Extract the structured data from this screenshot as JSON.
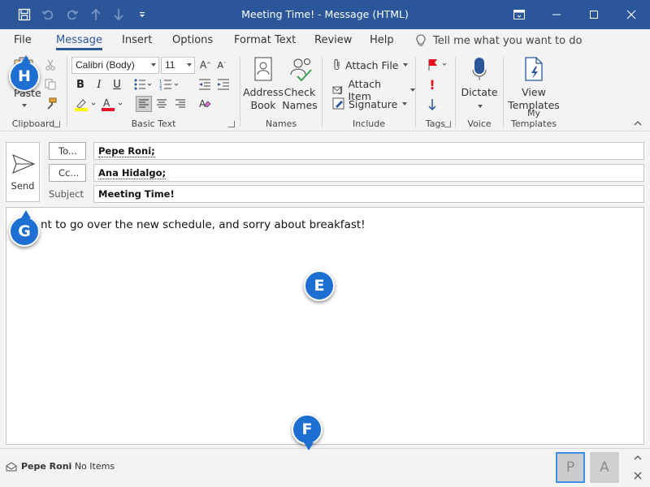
{
  "window": {
    "title": "Meeting Time! - Message (HTML)"
  },
  "menu": {
    "tabs": [
      "File",
      "Message",
      "Insert",
      "Options",
      "Format Text",
      "Review",
      "Help"
    ],
    "active_tab": "Message",
    "tell_me": "Tell me what you want to do"
  },
  "ribbon": {
    "clipboard": {
      "label": "Clipboard",
      "paste": "Paste"
    },
    "basic_text": {
      "label": "Basic Text",
      "font": "Calibri (Body)",
      "size": "11"
    },
    "names": {
      "label": "Names",
      "address_book": [
        "Address",
        "Book"
      ],
      "check_names": [
        "Check",
        "Names"
      ]
    },
    "include": {
      "label": "Include",
      "attach_file": "Attach File",
      "attach_item": "Attach Item",
      "signature": "Signature"
    },
    "tags": {
      "label": "Tags"
    },
    "voice": {
      "label": "Voice",
      "dictate": "Dictate"
    },
    "my_templates": {
      "label": "My Templates",
      "view_templates": [
        "View",
        "Templates"
      ]
    }
  },
  "compose": {
    "send_label": "Send",
    "to_label": "To...",
    "to_value": "Pepe Roni;",
    "cc_label": "Cc...",
    "cc_value": "Ana Hidalgo;",
    "subject_label": "Subject",
    "subject_value": "Meeting Time!",
    "body_text": "nt to go over the new schedule, and sorry about breakfast!"
  },
  "status": {
    "person": "Pepe Roni",
    "items": "No Items",
    "avatars": [
      "P",
      "A"
    ]
  },
  "callouts": [
    "H",
    "G",
    "E",
    "F"
  ],
  "colors": {
    "titlebar": "#2b579a",
    "accent": "#2b579a",
    "callout": "#1d6fd1",
    "flag": "#e81123",
    "font_color_red": "#e81123",
    "highlight_yellow": "#ffff00"
  }
}
